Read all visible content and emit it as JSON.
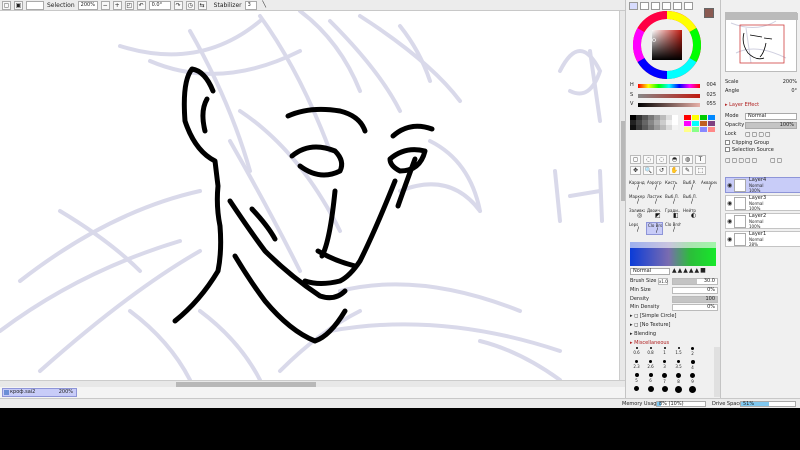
{
  "toolbar": {
    "selection_label": "Selection",
    "zoom_value": "200%",
    "rotation_value": "0.0°",
    "stabilizer_label": "Stabilizer",
    "stabilizer_value": "3"
  },
  "document": {
    "tab_name": "кроф.sai2",
    "tab_zoom": "200%"
  },
  "color": {
    "current_color": "#8a5a52",
    "h_label": "H",
    "h_value": "004",
    "s_label": "S",
    "s_value": "025",
    "v_label": "V",
    "v_value": "055"
  },
  "tools": {
    "row1": [
      "◻",
      "◌",
      "◌",
      "◓",
      "◍",
      "T"
    ],
    "row2": [
      "✥",
      "🔍",
      "↺",
      "✋",
      "✎",
      "⬚"
    ]
  },
  "brushes": [
    {
      "label": "Карандаш",
      "glyph": "/"
    },
    {
      "label": "Аэрогр",
      "glyph": "/"
    },
    {
      "label": "Кисть",
      "glyph": "/"
    },
    {
      "label": "Выб.Р.",
      "glyph": "/"
    },
    {
      "label": "Акварель",
      "glyph": "/"
    },
    {
      "label": "Маркер",
      "glyph": "/"
    },
    {
      "label": "Ластик",
      "glyph": "/"
    },
    {
      "label": "Выб.Л.",
      "glyph": "/"
    },
    {
      "label": "Выб.Л.",
      "glyph": "/"
    },
    {
      "label": "",
      "glyph": ""
    },
    {
      "label": "Заливка",
      "glyph": "◎"
    },
    {
      "label": "Двоич.",
      "glyph": "◩"
    },
    {
      "label": "Гради..",
      "glyph": "◧"
    },
    {
      "label": "Нейтр",
      "glyph": "◐"
    },
    {
      "label": "",
      "glyph": ""
    },
    {
      "label": "Leps",
      "glyph": "/"
    },
    {
      "label": "Clo Brsh",
      "glyph": "/"
    },
    {
      "label": "Clo Brsh",
      "glyph": "/"
    },
    {
      "label": "",
      "glyph": ""
    },
    {
      "label": "",
      "glyph": ""
    }
  ],
  "brush_props": {
    "blend_mode": "Normal",
    "brush_size_label": "Brush Size",
    "brush_size_mult": "x1.0",
    "brush_size_value": "30.0",
    "min_size_label": "Min Size",
    "min_size_value": "0%",
    "density_label": "Density",
    "density_value": "100",
    "min_density_label": "Min Density",
    "min_density_value": "0%",
    "shape_value": "[Simple Circle]",
    "texture_value": "[No Texture]",
    "blending_label": "Blending",
    "misc_label": "Miscellaneous"
  },
  "size_presets": [
    {
      "label": "0.6",
      "d": 1
    },
    {
      "label": "0.8",
      "d": 1
    },
    {
      "label": "1",
      "d": 1
    },
    {
      "label": "1.5",
      "d": 1
    },
    {
      "label": "2",
      "d": 2
    },
    {
      "label": "",
      "d": 0
    },
    {
      "label": "2.3",
      "d": 2
    },
    {
      "label": "2.6",
      "d": 2
    },
    {
      "label": "3",
      "d": 2
    },
    {
      "label": "3.5",
      "d": 2
    },
    {
      "label": "4",
      "d": 3
    },
    {
      "label": "",
      "d": 0
    },
    {
      "label": "5",
      "d": 3
    },
    {
      "label": "6",
      "d": 3
    },
    {
      "label": "7",
      "d": 4
    },
    {
      "label": "8",
      "d": 4
    },
    {
      "label": "9",
      "d": 4
    },
    {
      "label": "",
      "d": 0
    },
    {
      "label": "",
      "d": 4
    },
    {
      "label": "",
      "d": 5
    },
    {
      "label": "",
      "d": 5
    },
    {
      "label": "",
      "d": 6
    },
    {
      "label": "",
      "d": 6
    },
    {
      "label": "",
      "d": 0
    }
  ],
  "navigator": {
    "scale_label": "Scale",
    "scale_value": "200%",
    "angle_label": "Angle",
    "angle_value": "0°"
  },
  "layer_panel": {
    "layer_effect_label": "Layer Effect",
    "mode_label": "Mode",
    "mode_value": "Normal",
    "opacity_label": "Opacity",
    "opacity_value": "100%",
    "lock_label": "Lock",
    "clipping_label": "Clipping Group",
    "selection_source_label": "Selection Source",
    "layers": [
      {
        "name": "Layer4",
        "mode": "Normal",
        "opacity": "100%",
        "selected": true
      },
      {
        "name": "Layer3",
        "mode": "Normal",
        "opacity": "100%",
        "selected": false
      },
      {
        "name": "Layer2",
        "mode": "Normal",
        "opacity": "100%",
        "selected": false
      },
      {
        "name": "Layer1",
        "mode": "Normal",
        "opacity": "28%",
        "selected": false
      }
    ]
  },
  "status": {
    "memory_label": "Memory Usage",
    "memory_value": "8% (10%)",
    "memory_fraction": 0.08,
    "drive_label": "Drive Space",
    "drive_value": "51%",
    "drive_fraction": 0.51
  },
  "colors": {
    "sketch_lines": "#d9d9ea",
    "ink": "#000000",
    "selection": "#c8ccf8"
  }
}
